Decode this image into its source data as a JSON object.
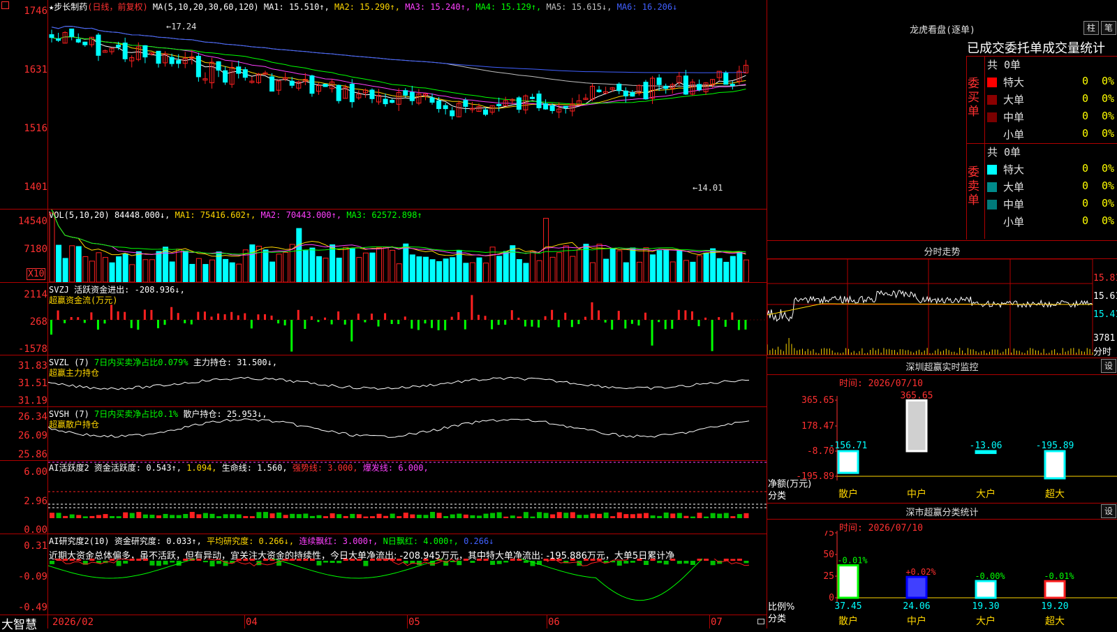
{
  "header": {
    "stock_name": "★步长制药",
    "period": "(日线，前复权)",
    "ma_label": "MA(5,10,20,30,60,120)",
    "ma1": "MA1: 15.510↑,",
    "ma2": "MA2: 15.290↑,",
    "ma3": "MA3: 15.240↑,",
    "ma4": "MA4: 15.129↑,",
    "ma5": "MA5: 15.615↓,",
    "ma6": "MA6: 16.206↓"
  },
  "price_axis": [
    "1746",
    "1631",
    "1516",
    "1401"
  ],
  "annotations": {
    "high": "17.24",
    "low": "14.01"
  },
  "vol": {
    "label": "VOL(5,10,20)",
    "v": "84448.000↓,",
    "ma1": "MA1: 75416.602↑,",
    "ma2": "MA2: 70443.000↑,",
    "ma3": "MA3: 62572.898↑",
    "axis": [
      "14540",
      "7180"
    ],
    "unit": "X10"
  },
  "svzj": {
    "label": "SVZJ",
    "text": "活跃资金进出: -208.936↓,",
    "sub": "超赢资金流(万元)",
    "axis": [
      "2114",
      "268",
      "-1578"
    ]
  },
  "svzl": {
    "label": "SVZL (7)",
    "ratio": "7日内买卖净占比0.079%",
    "hold": "主力持仓: 31.500↓,",
    "sub": "超赢主力持仓",
    "axis": [
      "31.83",
      "31.51",
      "31.19"
    ]
  },
  "svsh": {
    "label": "SVSH (7)",
    "ratio": "7日内买卖净占比0.1%",
    "hold": "散户持仓: 25.953↓,",
    "sub": "超赢散户持仓",
    "axis": [
      "26.34",
      "26.09",
      "25.86"
    ]
  },
  "ai_active": {
    "label": "AI活跃度2",
    "a": "资金活跃度: 0.543↑,",
    "b": "1.094,",
    "c": "生命线: 1.560,",
    "d": "强势线: 3.000,",
    "e": "爆发线: 6.000,",
    "axis": [
      "6.00",
      "2.96",
      "0.00"
    ]
  },
  "ai_research": {
    "label": "AI研究度2(10)",
    "a": "资金研究度: 0.033↑,",
    "b": "平均研究度: 0.266↓,",
    "c": "连续飘红: 3.000↑,",
    "d": "N日飘红: 4.000↑,",
    "e": "0.266↓",
    "note": "近期大资金总体偏多，虽不活跃，但有异动，宜关注大资金的持续性，今日大单净流出: -208.945万元，其中特大单净流出: -195.886万元，大单5日累计净",
    "axis": [
      "0.31",
      "-0.09",
      "-0.49"
    ]
  },
  "date_axis": [
    "2026/02",
    "04",
    "05",
    "06",
    "07"
  ],
  "brand": "大智慧",
  "lhb": {
    "title": "龙虎看盘(逐单)",
    "btn1": "柱",
    "btn2": "笔",
    "subtitle": "已成交委托单成交量统计",
    "buy_label": "委买单",
    "sell_label": "委卖单",
    "buy_total": "共 0单",
    "sell_total": "共 0单",
    "rows": [
      "特大",
      "大单",
      "中单",
      "小单"
    ],
    "buy_colors": [
      "#ff0000",
      "#8b0000",
      "#7a0000",
      "#000000"
    ],
    "sell_colors": [
      "#00ffff",
      "#008b8b",
      "#007a7a",
      "#000000"
    ],
    "count": "0",
    "pct": "0%"
  },
  "fenshi": {
    "title": "分时走势",
    "axis": [
      "15.81",
      "15.61",
      "15.41"
    ],
    "vol": "3781",
    "vol_unit": "分时"
  },
  "sz_monitor": {
    "title": "深圳超赢实时监控",
    "set": "设",
    "time": "时间: 2026/07/10",
    "axis": [
      "365.65",
      "178.47",
      "-8.70",
      "-195.89"
    ],
    "values": [
      "-156.71",
      "365.65",
      "-13.06",
      "-195.89"
    ],
    "nums": [
      -156.71,
      365.65,
      -13.06,
      -195.89
    ],
    "ylabel": "净额(万元)",
    "xlabel": "分类",
    "cats": [
      "散户",
      "中户",
      "大户",
      "超大"
    ]
  },
  "sz_class": {
    "title": "深市超赢分类统计",
    "set": "设",
    "time": "时间: 2026/07/10",
    "axis": [
      "75",
      "50",
      "25",
      "0"
    ],
    "deltas": [
      "-0.01%",
      "+0.02%",
      "-0.00%",
      "-0.01%"
    ],
    "values": [
      "37.45",
      "24.06",
      "19.30",
      "19.20"
    ],
    "nums": [
      37.45,
      24.06,
      19.3,
      19.2
    ],
    "ylabel": "比例%",
    "xlabel": "分类",
    "cats": [
      "散户",
      "中户",
      "大户",
      "超大"
    ]
  }
}
